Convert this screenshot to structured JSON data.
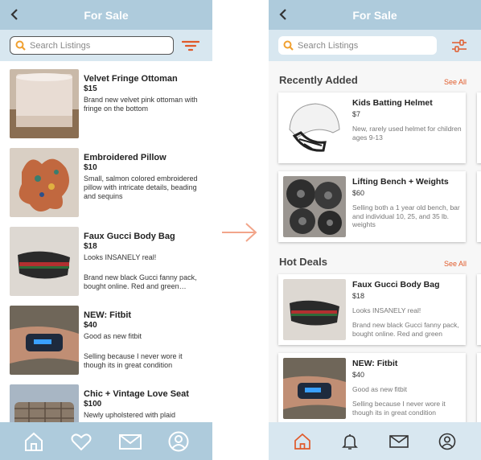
{
  "header": {
    "title": "For Sale"
  },
  "search": {
    "placeholder": "Search Listings"
  },
  "colors": {
    "accent": "#e05a2a",
    "header_bg": "#aecbdc",
    "search_bg": "#d8e7f0",
    "arrow": "#f2a58a"
  },
  "left_list": [
    {
      "title": "Velvet Fringe Ottoman",
      "price": "$15",
      "desc": "Brand new velvet pink ottoman with fringe on the bottom",
      "desc2": ""
    },
    {
      "title": "Embroidered Pillow",
      "price": "$10",
      "desc": "Small, salmon colored embroidered pillow with intricate details, beading and sequins",
      "desc2": ""
    },
    {
      "title": "Faux Gucci Body Bag",
      "price": "$18",
      "desc": "Looks INSANELY real!",
      "desc2": "Brand new black Gucci fanny pack, bought online. Red and green…"
    },
    {
      "title": "NEW: Fitbit",
      "price": "$40",
      "desc": "Good as new fitbit",
      "desc2": "Selling because I never wore it though its in great condition"
    },
    {
      "title": "Chic + Vintage Love Seat",
      "price": "$100",
      "desc": "Newly upholstered with plaid",
      "desc2": ""
    }
  ],
  "recently_added": {
    "heading": "Recently Added",
    "see_all": "See All",
    "items": [
      {
        "title": "Kids Batting Helmet",
        "price": "$7",
        "desc": "New, rarely used helmet for children ages 9-13",
        "desc2": ""
      },
      {
        "title": "Lifting Bench + Weights",
        "price": "$60",
        "desc": "Selling both a 1 year old bench, bar and individual 10, 25, and 35 lb. weights",
        "desc2": ""
      }
    ]
  },
  "hot_deals": {
    "heading": "Hot Deals",
    "see_all": "See All",
    "items": [
      {
        "title": "Faux Gucci Body Bag",
        "price": "$18",
        "desc": "Looks INSANELY real!",
        "desc2": "Brand new black Gucci fanny pack, bought online. Red and green"
      },
      {
        "title": "NEW: Fitbit",
        "price": "$40",
        "desc": "Good as new fitbit",
        "desc2": "Selling because I never wore it though its in great condition"
      }
    ]
  },
  "left_nav": [
    "home-icon",
    "heart-icon",
    "mail-icon",
    "profile-icon"
  ],
  "right_nav": [
    "home-icon",
    "bell-icon",
    "mail-icon",
    "profile-icon"
  ]
}
